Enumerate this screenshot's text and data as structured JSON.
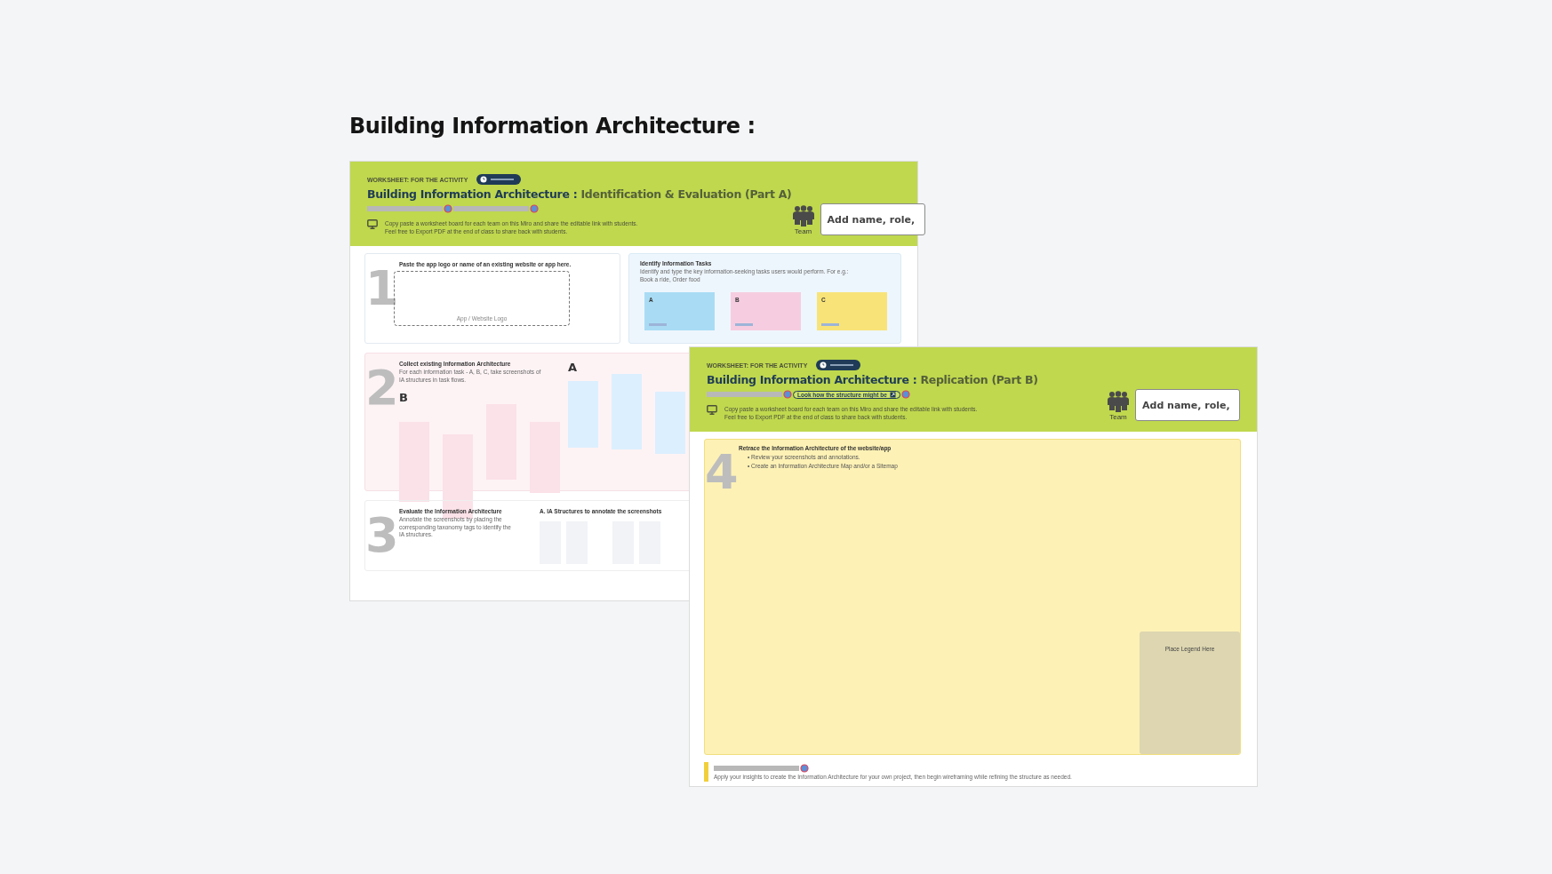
{
  "page_title": "Building Information Architecture :",
  "worksheets": [
    {
      "eyebrow": "WORKSHEET: FOR THE ACTIVITY",
      "title": "Building Information Architecture :",
      "subtitle": "Identification & Evaluation (Part A)",
      "instructions": [
        "Copy paste a worksheet board for each team on this Miro and share the editable link with students.",
        "Feel free to Export PDF at the end of class to share back with students."
      ],
      "team_label": "Team",
      "name_value": "Add name, role,",
      "sections": [
        {
          "kind": "logo_tasks",
          "number": "1",
          "heading": "Paste the app logo or name of an existing website or app here.",
          "logo_label": "App / Website Logo",
          "tasks_heading": "Identify Information Tasks",
          "tasks_text": "Identify and type the key information-seeking tasks users would perform. For e.g.: Book a ride, Order food",
          "notes": [
            {
              "label": "A",
              "color": "#a9dcf4"
            },
            {
              "label": "B",
              "color": "#f6cde0"
            },
            {
              "label": "C",
              "color": "#f8e379"
            }
          ]
        },
        {
          "kind": "collect",
          "number": "2",
          "heading": "Collect existing Information Architecture",
          "text": "For each information task - A, B, C, take screenshots of IA structures in task flows.",
          "groups": [
            {
              "label": "B",
              "color": "#fbe1e8"
            },
            {
              "label": "A",
              "color": "#dcefff"
            }
          ]
        },
        {
          "kind": "evaluate",
          "number": "3",
          "heading": "Evaluate the Information Architecture",
          "text": "Annotate the screenshots by placing the corresponding taxonomy tags to identify the IA structures.",
          "side_heading": "A. IA Structures to annotate the screenshots"
        }
      ]
    },
    {
      "eyebrow": "WORKSHEET: FOR THE ACTIVITY",
      "title": "Building Information Architecture :",
      "subtitle": "Replication (Part B)",
      "link": "Look how the structure might be",
      "instructions": [
        "Copy paste a worksheet board for each team on this Miro and share the editable link with students.",
        "Feel free to Export PDF at the end of class to share back with students."
      ],
      "team_label": "Team",
      "name_value": "Add name, role,",
      "sections": [
        {
          "kind": "retrace",
          "number": "4",
          "heading": "Retrace the Information Architecture of the website/app",
          "bullet_marker": "•",
          "bullets": [
            "Review your screenshots and annotations.",
            "Create  an Information Architecture Map and/or a Sitemap"
          ],
          "legend": "Place Legend Here"
        }
      ],
      "footer": "Apply your insights to create the Information Architecture for your own project, then begin wireframing while refining the structure as needed."
    }
  ]
}
